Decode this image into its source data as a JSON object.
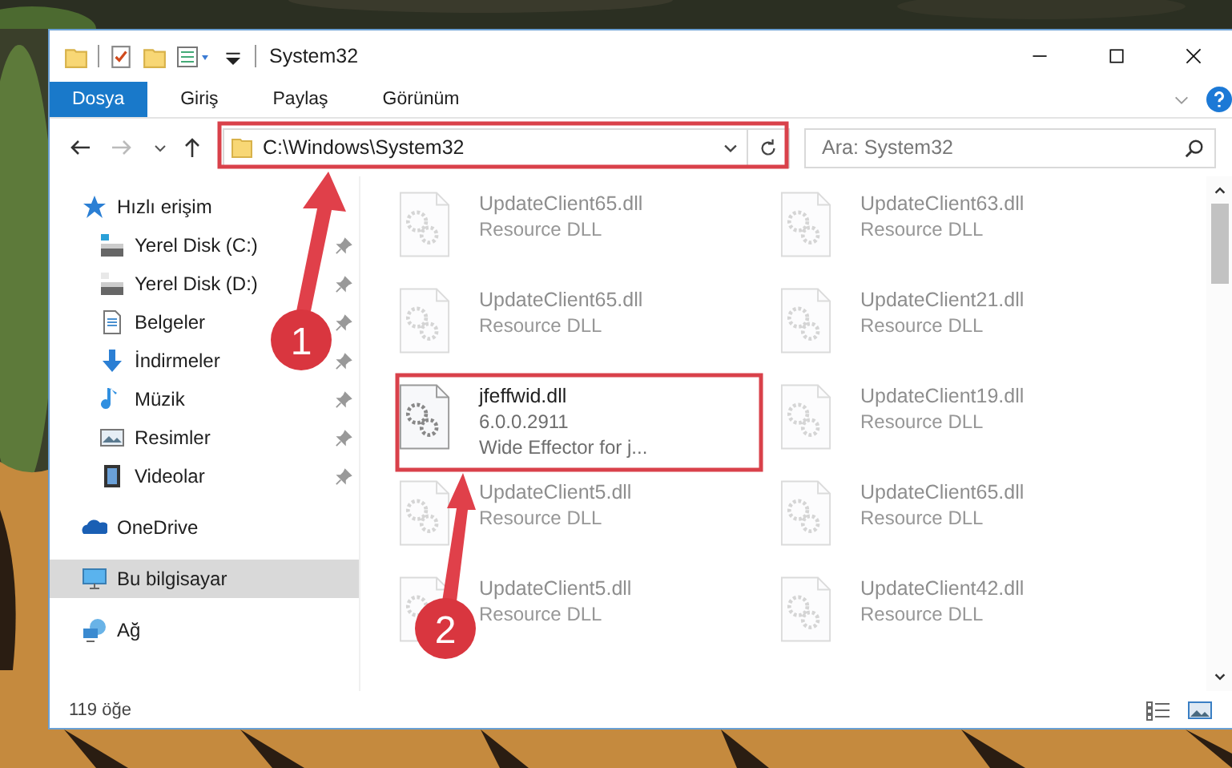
{
  "window": {
    "title": "System32"
  },
  "ribbon": {
    "tabs": [
      {
        "label": "Dosya",
        "kind": "file",
        "selected": false
      },
      {
        "label": "Giriş",
        "kind": "tab",
        "selected": false
      },
      {
        "label": "Paylaş",
        "kind": "tab",
        "selected": false
      },
      {
        "label": "Görünüm",
        "kind": "tab",
        "selected": false
      }
    ]
  },
  "address_bar": {
    "path": "C:\\Windows\\System32"
  },
  "search": {
    "placeholder": "Ara: System32"
  },
  "sidebar": {
    "items": [
      {
        "label": "Hızlı erişim",
        "selected": false,
        "children": [
          {
            "label": "Yerel Disk (C:)",
            "pinned": true,
            "selected": false
          },
          {
            "label": "Yerel Disk (D:)",
            "pinned": true,
            "selected": false
          },
          {
            "label": "Belgeler",
            "pinned": true,
            "selected": false
          },
          {
            "label": "İndirmeler",
            "pinned": true,
            "selected": false
          },
          {
            "label": "Müzik",
            "pinned": true,
            "selected": false
          },
          {
            "label": "Resimler",
            "pinned": true,
            "selected": false
          },
          {
            "label": "Videolar",
            "pinned": true,
            "selected": false
          }
        ]
      },
      {
        "label": "OneDrive",
        "selected": false
      },
      {
        "label": "Bu bilgisayar",
        "selected": true
      },
      {
        "label": "Ağ",
        "selected": false
      }
    ]
  },
  "files": [
    {
      "name": "UpdateClient65.dll",
      "details": [
        "Resource DLL"
      ],
      "faded": true
    },
    {
      "name": "UpdateClient63.dll",
      "details": [
        "Resource DLL"
      ],
      "faded": true
    },
    {
      "name": "UpdateClient65.dll",
      "details": [
        "Resource DLL"
      ],
      "faded": true
    },
    {
      "name": "UpdateClient21.dll",
      "details": [
        "Resource DLL"
      ],
      "faded": true
    },
    {
      "name": "jfeffwid.dll",
      "details": [
        "6.0.0.2911",
        "Wide Effector for j..."
      ],
      "faded": false
    },
    {
      "name": "UpdateClient19.dll",
      "details": [
        "Resource DLL"
      ],
      "faded": true
    },
    {
      "name": "UpdateClient5.dll",
      "details": [
        "Resource DLL"
      ],
      "faded": true
    },
    {
      "name": "UpdateClient65.dll",
      "details": [
        "Resource DLL"
      ],
      "faded": true
    },
    {
      "name": "UpdateClient5.dll",
      "details": [
        "Resource DLL"
      ],
      "faded": true
    },
    {
      "name": "UpdateClient42.dll",
      "details": [
        "Resource DLL"
      ],
      "faded": true
    }
  ],
  "status_bar": {
    "item_count": "119 öğe"
  },
  "annotations": [
    {
      "number": "1"
    },
    {
      "number": "2"
    }
  ]
}
